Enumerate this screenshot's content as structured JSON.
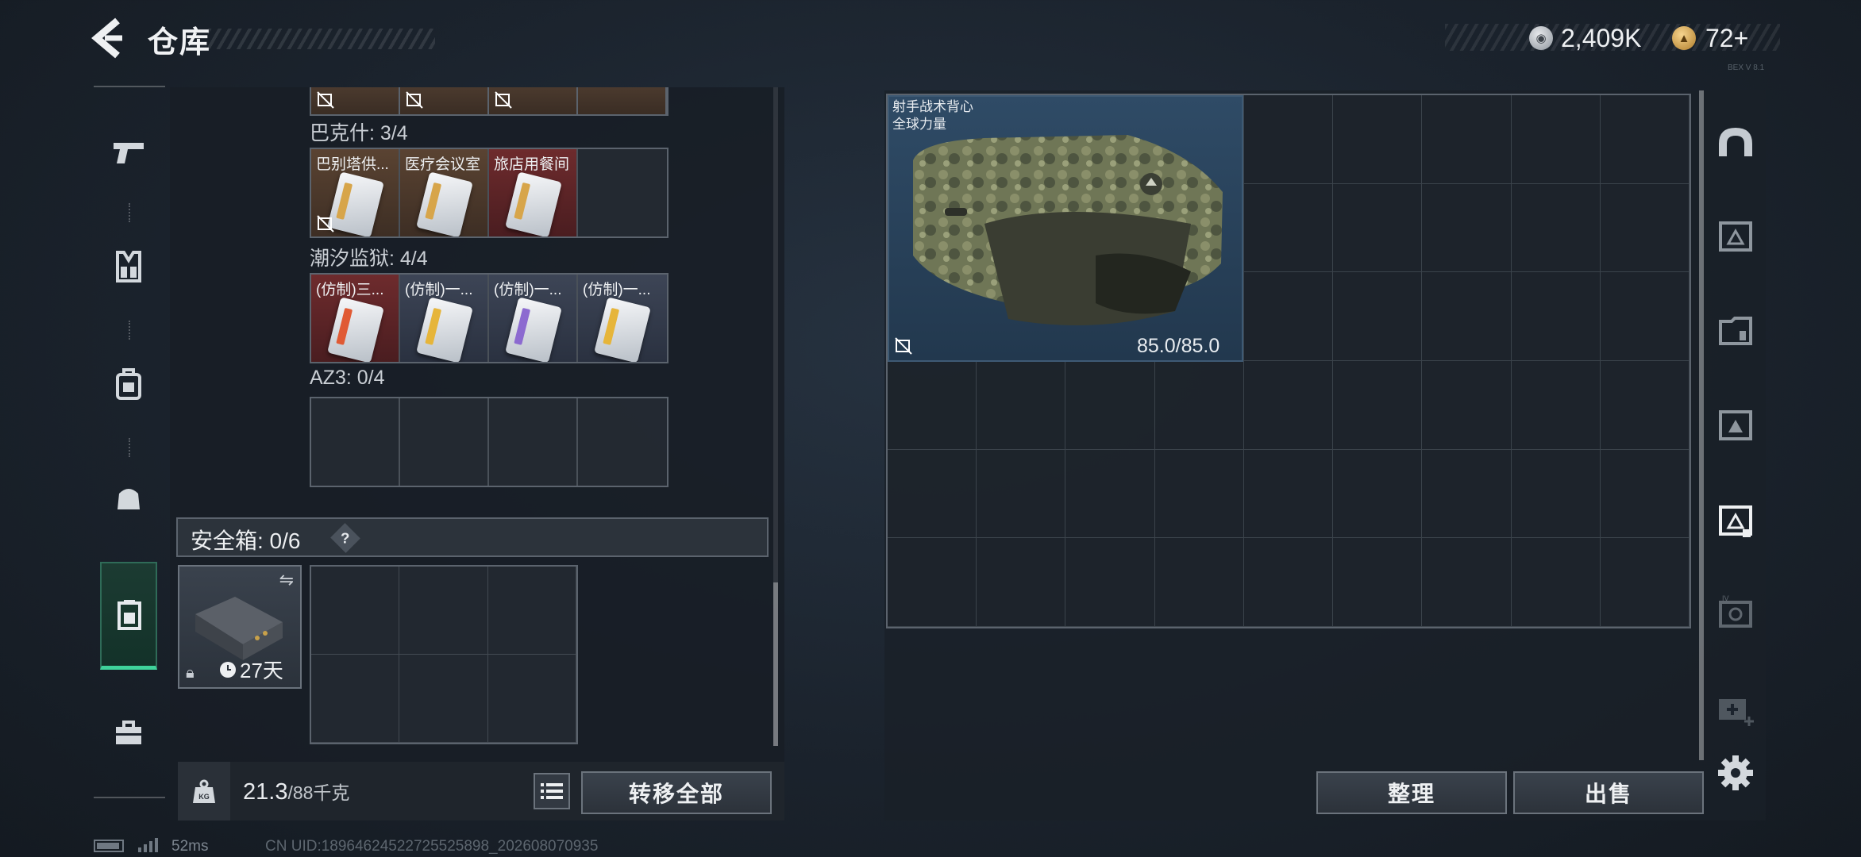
{
  "header": {
    "title": "仓库",
    "silver_value": "2,409K",
    "gold_value": "72+",
    "corner_code": "BEX V 8.1"
  },
  "left_nav": {
    "items": [
      "pistol-icon",
      "chest-rig-icon",
      "backpack-icon",
      "pouch-icon",
      "safe-box-icon",
      "toolbox-icon"
    ],
    "selected": "safe-box-icon"
  },
  "key_cards": {
    "bakshi": {
      "label": "巴克什: 3/4",
      "cells": [
        {
          "name": "巴别塔供...",
          "color": "brown"
        },
        {
          "name": "医疗会议室",
          "color": "brown"
        },
        {
          "name": "旅店用餐间",
          "color": "red"
        },
        {
          "name": "",
          "color": "empty"
        }
      ]
    },
    "tide_prison": {
      "label": "潮汐监狱: 4/4",
      "cells": [
        {
          "name": "(仿制)三...",
          "color": "red"
        },
        {
          "name": "(仿制)一...",
          "color": "blue"
        },
        {
          "name": "(仿制)一...",
          "color": "blue"
        },
        {
          "name": "(仿制)一...",
          "color": "blue"
        }
      ]
    },
    "az3": {
      "label": "AZ3: 0/4"
    }
  },
  "safe_box": {
    "label": "安全箱: 0/6",
    "help": "?",
    "timer": "27天"
  },
  "weight": {
    "current": "21.3",
    "total": "/88千克"
  },
  "buttons": {
    "transfer_all": "转移全部",
    "sort": "整理",
    "sell": "出售"
  },
  "stash": {
    "item": {
      "name_line1": "射手战术背心",
      "name_line2": "全球力量",
      "durability": "85.0/85.0"
    }
  },
  "right_nav": {
    "items": [
      "helmet-icon",
      "armor-slot-1-icon",
      "armor-slot-2-icon",
      "armor-slot-3-icon",
      "armor-slot-4-icon",
      "armor-slot-5-icon",
      "medkit-add-icon"
    ],
    "selected": "armor-slot-4-icon"
  },
  "status": {
    "ping": "52ms",
    "uid": "CN UID:18964624522725525898_202608070935"
  },
  "colors": {
    "accent_green": "#3fd39b",
    "item_red": "#6e2b2d",
    "item_brown": "#5a4332",
    "item_blue": "#3d4556"
  }
}
